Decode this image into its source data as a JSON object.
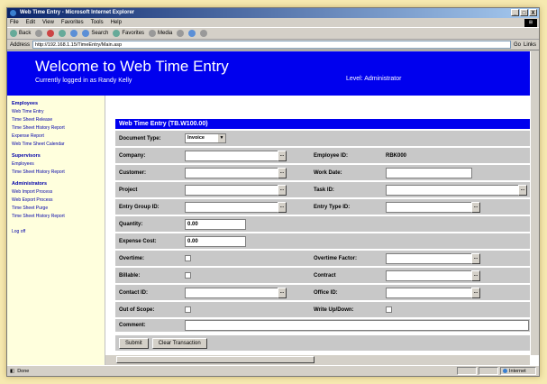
{
  "window": {
    "title": "Web Time Entry - Microsoft Internet Explorer",
    "controls": [
      "_",
      "□",
      "X"
    ]
  },
  "menubar": {
    "items": [
      "File",
      "Edit",
      "View",
      "Favorites",
      "Tools",
      "Help"
    ]
  },
  "toolbar": {
    "back": "Back",
    "search": "Search",
    "favorites": "Favorites",
    "media": "Media"
  },
  "addressbar": {
    "label": "Address",
    "url": "http://192.168.1.15/TimeEntry/Main.asp",
    "go": "Go",
    "links": "Links"
  },
  "banner": {
    "title": "Welcome to Web Time Entry",
    "user_line": "Currently logged in as Randy Kelly",
    "level": "Level: Administrator",
    "color": "#0000ee"
  },
  "sidebar": {
    "sections": [
      {
        "title": "Employees",
        "links": [
          "Web Time Entry",
          "Time Sheet Release",
          "Time Sheet History Report",
          "Expense Report",
          "Web Time Sheet Calendar"
        ]
      },
      {
        "title": "Supervisors",
        "links": [
          "Employees",
          "Time Sheet History Report"
        ]
      },
      {
        "title": "Administrators",
        "links": [
          "Web Import Process",
          "Web Export Process",
          "Time Sheet Purge",
          "Time Sheet History Report"
        ]
      }
    ],
    "logoff": "Log off"
  },
  "form": {
    "header": "Web Time Entry (TB.W100.00)",
    "document_type_label": "Document Type:",
    "document_type_value": "Invoice",
    "company_label": "Company:",
    "employee_id_label": "Employee ID:",
    "employee_id_value": "RBK000",
    "customer_label": "Customer:",
    "work_date_label": "Work Date:",
    "project_label": "Project",
    "task_id_label": "Task ID:",
    "entry_group_id_label": "Entry Group ID:",
    "entry_type_id_label": "Entry Type ID:",
    "quantity_label": "Quantity:",
    "quantity_value": "0.00",
    "expense_cost_label": "Expense Cost:",
    "expense_cost_value": "0.00",
    "overtime_label": "Overtime:",
    "overtime_factor_label": "Overtime Factor:",
    "billable_label": "Billable:",
    "contract_label": "Contract",
    "contact_id_label": "Contact ID:",
    "office_id_label": "Office ID:",
    "out_of_scope_label": "Out of Scope:",
    "write_up_down_label": "Write Up/Down:",
    "comment_label": "Comment:",
    "submit_label": "Submit",
    "clear_label": "Clear Transaction",
    "lookup_glyph": "..."
  },
  "statusbar": {
    "text": "Done",
    "zone": "Internet"
  }
}
